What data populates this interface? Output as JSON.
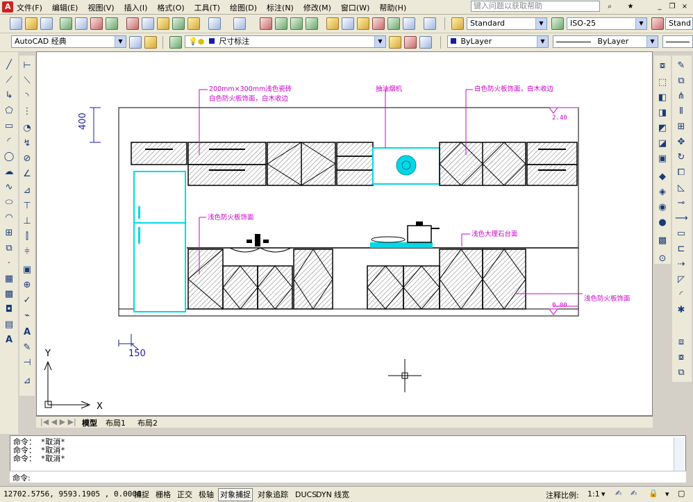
{
  "app": {
    "menus": [
      "文件(F)",
      "编辑(E)",
      "视图(V)",
      "插入(I)",
      "格式(O)",
      "工具(T)",
      "绘图(D)",
      "标注(N)",
      "修改(M)",
      "窗口(W)",
      "帮助(H)"
    ],
    "help_placeholder": "键入问题以获取帮助",
    "window_buttons": {
      "minimize": "_",
      "restore": "❐",
      "close": "×"
    }
  },
  "toolbar": {
    "text_style": "Standard",
    "dim_style": "ISO-25",
    "table_style": "Stand",
    "workspace": "AutoCAD 经典",
    "layer": "尺寸标注",
    "color": "ByLayer",
    "linetype": "ByLayer",
    "lineweight": ""
  },
  "drawing": {
    "labels": {
      "top_left_1": "200mm×300mm浅色瓷砖",
      "top_left_2": "白色防火板饰面，白木收边",
      "hood": "抽油烟机",
      "top_right": "白色防火板饰面，白木收边",
      "mid_left": "浅色防火板饰面",
      "countertop": "浅色大理石台面",
      "bottom_right": "浅色防火板饰面"
    },
    "dims": {
      "vertical": "400",
      "horizontal": "150",
      "level_top": "2.40",
      "level_bottom": "0.00"
    },
    "ucs": {
      "x": "X",
      "y": "Y"
    },
    "colors": {
      "magenta": "#cc00cc",
      "cyan": "#00d8e8",
      "blue": "#1a1aa8"
    }
  },
  "tabs": [
    "模型",
    "布局1",
    "布局2"
  ],
  "command": {
    "history": [
      "命令：  *取消*",
      "命令：  *取消*",
      "命令：  *取消*"
    ],
    "prompt": "命令:"
  },
  "status": {
    "coords": "12702.5756,  9593.1905 ,  0.0000",
    "toggles": [
      {
        "label": "捕捉",
        "on": false
      },
      {
        "label": "栅格",
        "on": false
      },
      {
        "label": "正交",
        "on": false
      },
      {
        "label": "极轴",
        "on": false
      },
      {
        "label": "对象捕捉",
        "on": true
      },
      {
        "label": "对象追踪",
        "on": false
      },
      {
        "label": "DUCS",
        "on": false
      },
      {
        "label": "DYN",
        "on": false
      },
      {
        "label": "线宽",
        "on": false
      }
    ],
    "annotation_scale_label": "注释比例:",
    "annotation_scale": "1:1"
  }
}
